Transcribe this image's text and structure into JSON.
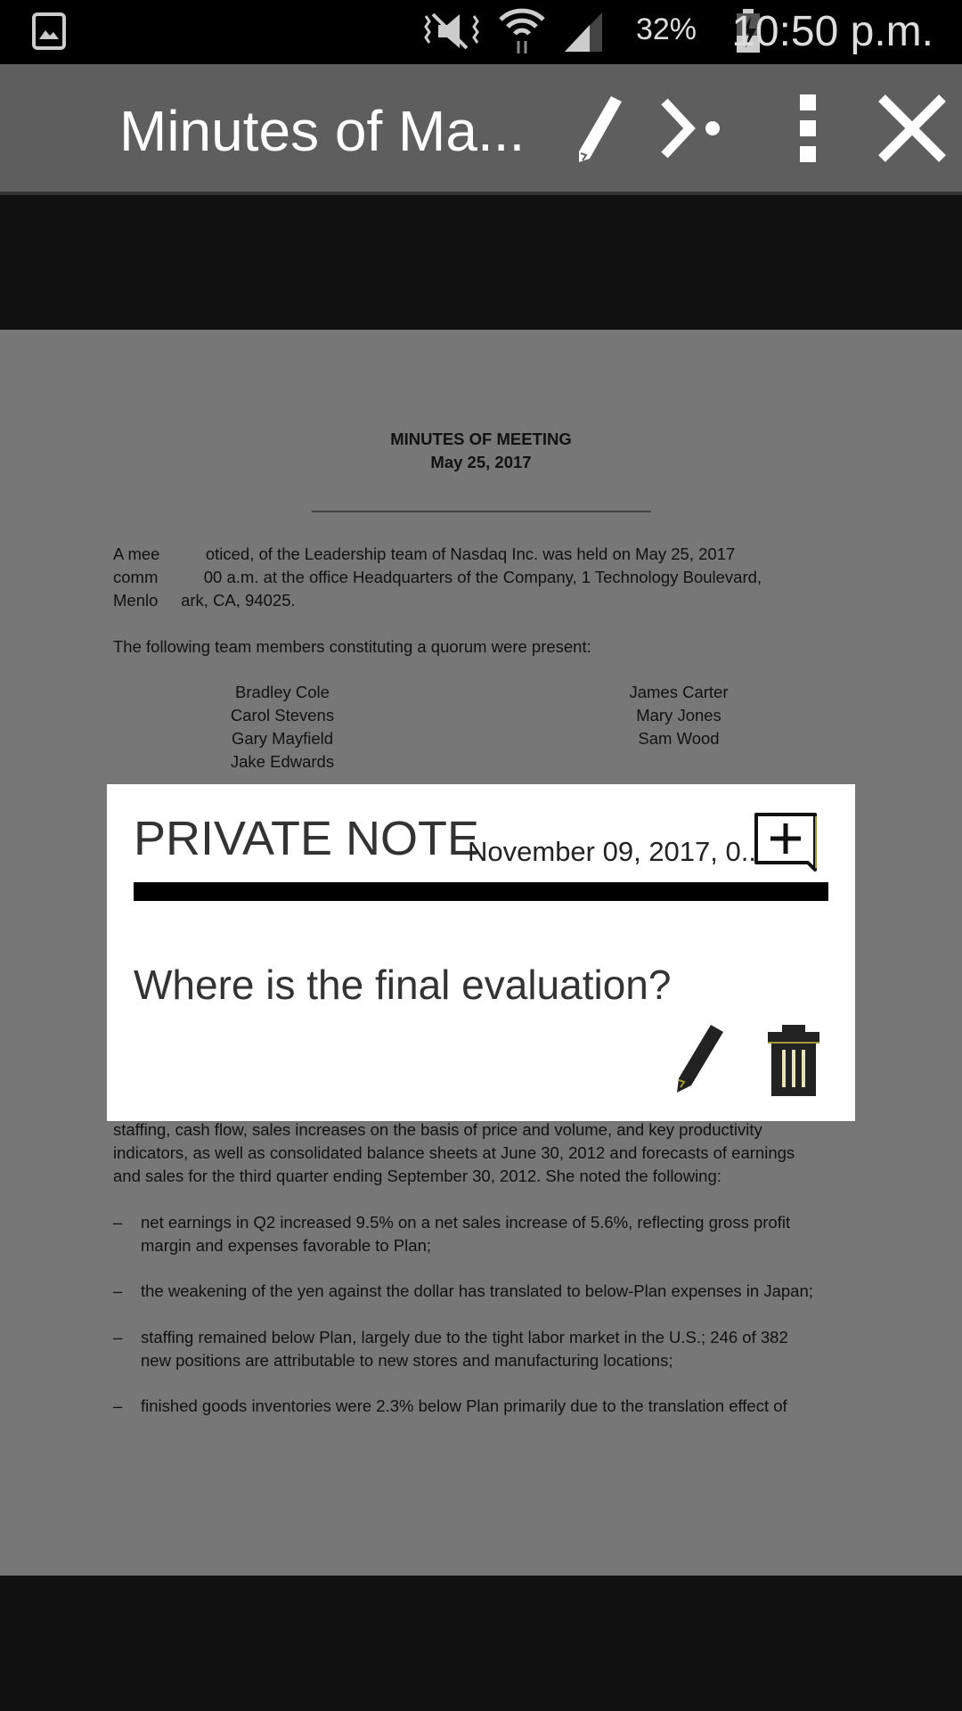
{
  "status_bar": {
    "battery": "32%",
    "time": "10:50 p.m.",
    "icons": [
      "gallery-icon",
      "mute-icon",
      "wifi-icon",
      "signal-icon",
      "battery-charging-icon"
    ]
  },
  "toolbar": {
    "title": "Minutes of Ma...",
    "icons": [
      "pencil-icon",
      "share-icon",
      "more-vert-icon",
      "close-icon"
    ]
  },
  "document": {
    "title": "MINUTES OF MEETING",
    "date": "May 25, 2017",
    "para1": [
      "A mee          oticed, of the Leadership team of Nasdaq Inc. was held on May 25, 2017",
      "comm          00 a.m. at the office Headquarters of the Company, 1 Technology Boulevard,",
      "Menlo     ark, CA, 94025."
    ],
    "para2": "The following team members constituting a quorum were present:",
    "members_left": [
      "Bradley Cole",
      "Carol Stevens",
      "Gary Mayfield",
      "Jake Edwards"
    ],
    "members_right": [
      "James Carter",
      "Mary Jones",
      "Sam Wood"
    ],
    "para3": [
      "staffing, cash flow, sales increases on the basis of price and volume, and key productivity",
      "indicators, as well as consolidated balance sheets at June 30, 2012 and forecasts of earnings",
      "and sales for the third quarter ending September 30, 2012. She noted the following:"
    ],
    "bullet_marker": "–",
    "bullets": [
      [
        "net earnings in Q2 increased 9.5% on a net sales increase of 5.6%, reflecting gross profit",
        "margin and expenses favorable to Plan;"
      ],
      [
        "the weakening of the yen against the dollar has translated to below-Plan expenses in Japan;"
      ],
      [
        "staffing remained below Plan, largely due to the tight labor market in the U.S.; 246 of 382",
        "new positions are attributable to new stores and manufacturing locations;"
      ],
      [
        "finished goods inventories were 2.3% below Plan primarily due to the translation effect of"
      ]
    ]
  },
  "note": {
    "heading": "PRIVATE NOTE",
    "date": "November 09, 2017, 0...",
    "text": "Where is the final evaluation?",
    "accent": "#a39a3c"
  }
}
